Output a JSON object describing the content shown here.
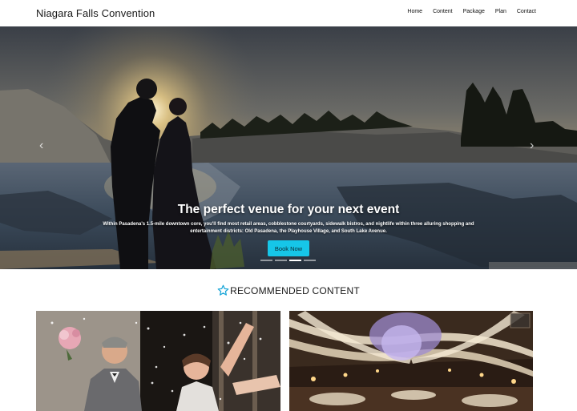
{
  "navbar": {
    "brand": "Niagara Falls Convention",
    "links": [
      {
        "label": "Home"
      },
      {
        "label": "Content"
      },
      {
        "label": "Package"
      },
      {
        "label": "Plan"
      },
      {
        "label": "Contact"
      }
    ]
  },
  "hero": {
    "title": "The perfect venue for your next event",
    "text": "Within Pasadena's 1.5-mile downtown core, you'll find most retail areas, cobblestone courtyards, sidewalk bistros, and nightlife within three alluring shopping and entertainment districts: Old Pasadena, the Playhouse Village, and South Lake Avenue.",
    "button_label": "Book Now",
    "prev_icon": "chevron-left-icon",
    "next_icon": "chevron-right-icon",
    "active_slide": 3,
    "slide_count": 4,
    "accent_color": "#16c6e8"
  },
  "recommended": {
    "title": "RECOMMENDED CONTENT",
    "icon": "star-outline-icon",
    "icon_color": "#1aa6d8"
  }
}
